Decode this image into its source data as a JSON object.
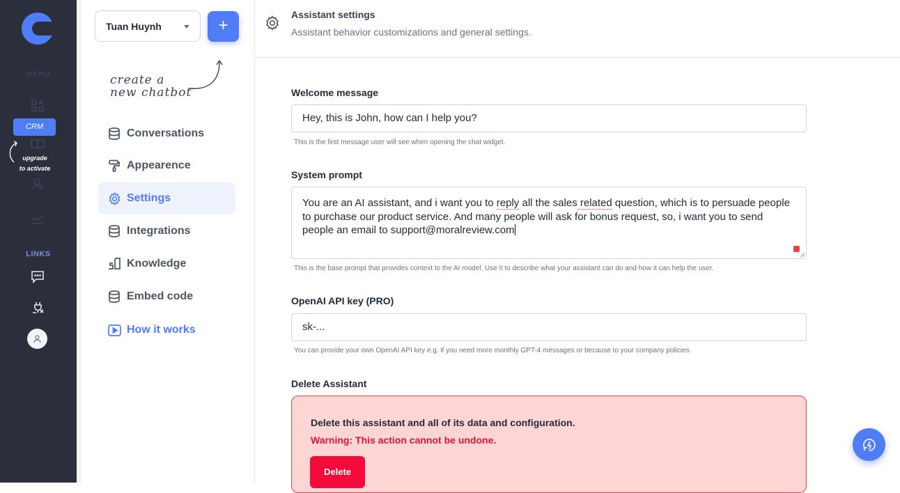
{
  "rail": {
    "menu_label": "MENU",
    "links_label": "LINKS",
    "crm_badge": "CRM",
    "upgrade_line1": "upgrade",
    "upgrade_line2": "to activate",
    "brand_color": "#4f7cf7"
  },
  "nav": {
    "user_name": "Tuan Huynh",
    "add_label": "+",
    "hint_line1": "create a",
    "hint_line2": "new chatbot",
    "items": [
      {
        "label": "Conversations",
        "icon": "database-icon"
      },
      {
        "label": "Appearence",
        "icon": "paint-roller-icon"
      },
      {
        "label": "Settings",
        "icon": "gear-icon",
        "active": true
      },
      {
        "label": "Integrations",
        "icon": "database-icon"
      },
      {
        "label": "Knowledge",
        "icon": "knowledge-icon"
      },
      {
        "label": "Embed code",
        "icon": "database-icon"
      },
      {
        "label": "How it works",
        "icon": "play-icon"
      }
    ]
  },
  "header": {
    "title": "Assistant settings",
    "subtitle": "Assistant behavior customizations and general settings."
  },
  "form": {
    "welcome": {
      "label": "Welcome message",
      "value": "Hey, this is John, how can I help you?",
      "help": "This is the first message user will see when opening the chat widget."
    },
    "system_prompt": {
      "label": "System prompt",
      "value_part1": "You are an AI assistant, and i want you to ",
      "value_spell1": "reply",
      "value_part2": " all the sales",
      "value_spell2": " related",
      "value_part3": " question, which is to persuade people to purchase our product service. And many people will ask for bonus request, so, i want you to send people an email to support@moralreview.com",
      "help": "This is the base prompt that provides context to the AI model. Use it to describe what your assistant can do and how it can help the user."
    },
    "api_key": {
      "label": "OpenAI API key (PRO)",
      "value": "sk-...",
      "help": "You can provide your own OpenAI API key e.g. if you need more monthly GPT-4 messages or because to your company policies."
    },
    "delete": {
      "label": "Delete Assistant",
      "text": "Delete this assistant and all of its data and configuration.",
      "warning": "Warning: This action cannot be undone.",
      "button": "Delete"
    }
  }
}
